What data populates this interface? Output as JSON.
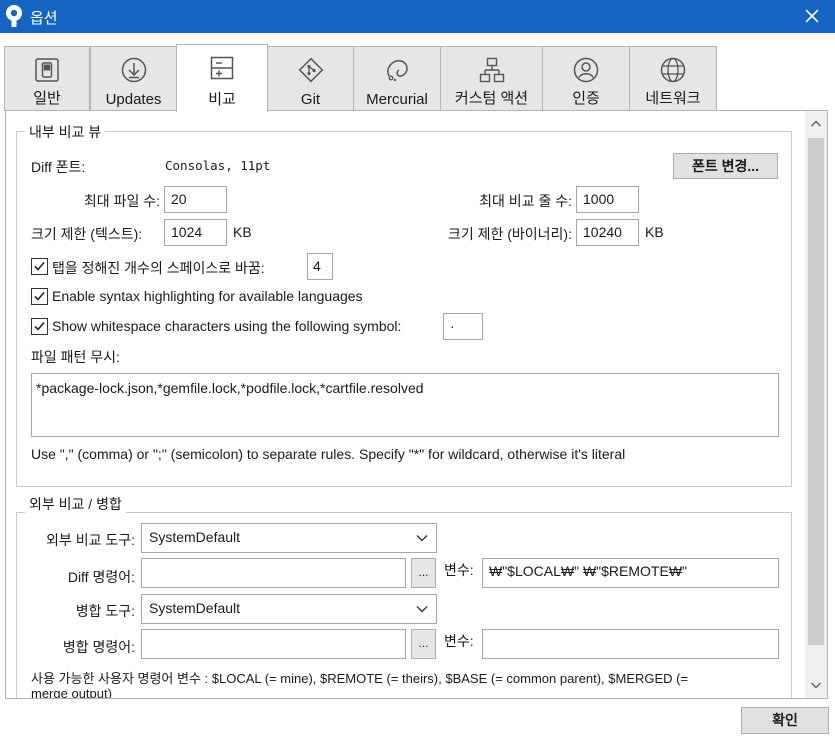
{
  "window": {
    "title": "옵션",
    "close_icon": "close-icon"
  },
  "tabs": [
    {
      "label": "일반",
      "icon": "general-icon"
    },
    {
      "label": "Updates",
      "icon": "updates-icon"
    },
    {
      "label": "비교",
      "icon": "diff-icon",
      "active": true
    },
    {
      "label": "Git",
      "icon": "git-icon"
    },
    {
      "label": "Mercurial",
      "icon": "mercurial-icon"
    },
    {
      "label": "커스텀 액션",
      "icon": "custom-actions-icon"
    },
    {
      "label": "인증",
      "icon": "auth-icon"
    },
    {
      "label": "네트워크",
      "icon": "network-icon"
    }
  ],
  "internal": {
    "title": "내부 비교 뷰",
    "font_label": "Diff 폰트:",
    "font_value": "Consolas, 11pt",
    "change_font_button": "폰트 변경...",
    "max_files_label": "최대 파일 수:",
    "max_files_value": "20",
    "max_lines_label": "최대 비교 줄 수:",
    "max_lines_value": "1000",
    "text_limit_label": "크기 제한 (텍스트):",
    "text_limit_value": "1024",
    "text_limit_unit": "KB",
    "binary_limit_label": "크기 제한 (바이너리):",
    "binary_limit_value": "10240",
    "binary_limit_unit": "KB",
    "tabs_to_spaces_label": "탭을 정해진 개수의 스페이스로 바꿈:",
    "tabs_to_spaces_checked": true,
    "tabs_to_spaces_value": "4",
    "syntax_label": "Enable syntax highlighting for available languages",
    "syntax_checked": true,
    "whitespace_label": "Show whitespace characters using the following symbol:",
    "whitespace_checked": true,
    "whitespace_symbol": "·",
    "ignore_label": "파일 패턴 무시:",
    "ignore_value": "*package-lock.json,*gemfile.lock,*podfile.lock,*cartfile.resolved",
    "ignore_help": "Use \",\" (comma) or \";\" (semicolon) to separate rules. Specify \"*\" for wildcard, otherwise it's literal"
  },
  "external": {
    "title": "외부 비교 / 병합",
    "diff_tool_label": "외부 비교 도구:",
    "diff_tool_value": "SystemDefault",
    "diff_cmd_label": "Diff 명령어:",
    "diff_cmd_value": "",
    "browse_label": "...",
    "diff_args_label": "변수:",
    "diff_args_value": "₩\"$LOCAL₩\" ₩\"$REMOTE₩\"",
    "merge_tool_label": "병합 도구:",
    "merge_tool_value": "SystemDefault",
    "merge_cmd_label": "병합 명령어:",
    "merge_cmd_value": "",
    "merge_args_label": "변수:",
    "merge_args_value": "",
    "help_line1": "사용 가능한 사용자 명령어 변수 : $LOCAL (= mine), $REMOTE (= theirs), $BASE (= common parent), $MERGED (=",
    "help_line2": "merge output)"
  },
  "footer": {
    "ok_button": "확인"
  }
}
